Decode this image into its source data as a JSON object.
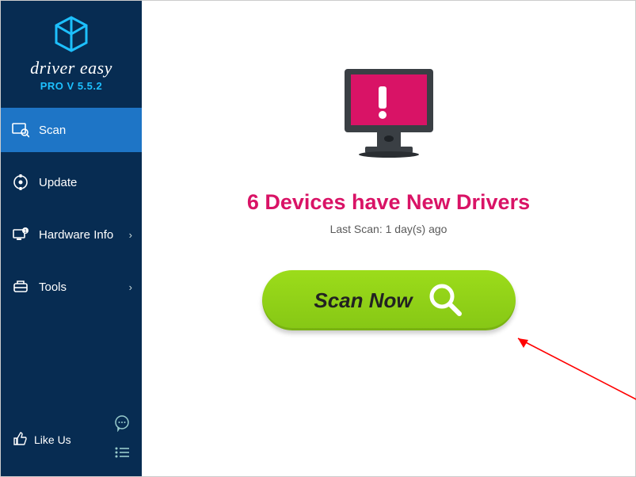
{
  "brand": {
    "name": "driver easy",
    "version": "PRO V 5.5.2"
  },
  "nav": {
    "scan": "Scan",
    "update": "Update",
    "hardware": "Hardware Info",
    "tools": "Tools"
  },
  "footer": {
    "like": "Like Us"
  },
  "main": {
    "headline": "6 Devices have New Drivers",
    "lastscan": "Last Scan: 1 day(s) ago",
    "scan_label": "Scan Now"
  },
  "controls": {
    "min": "—",
    "close": "✕"
  }
}
